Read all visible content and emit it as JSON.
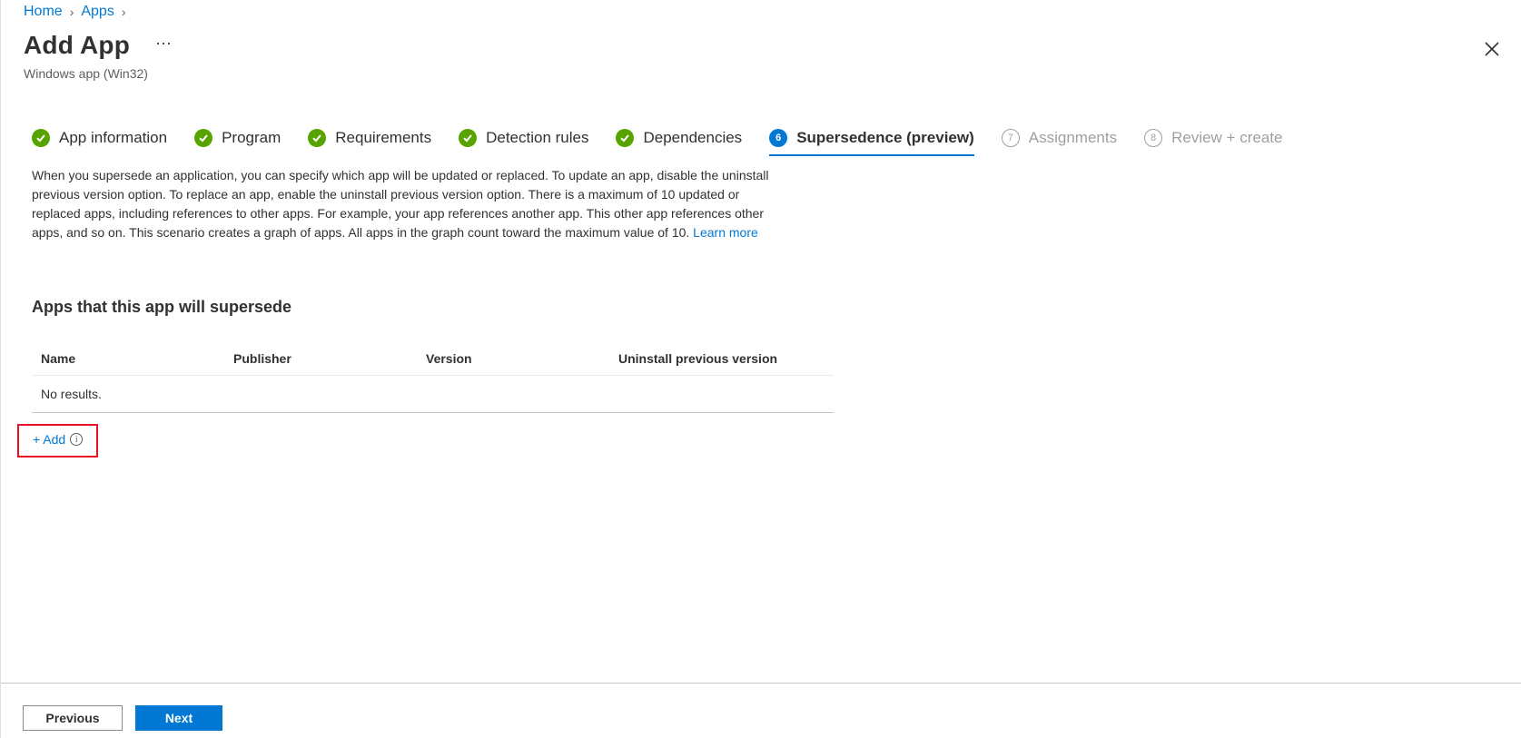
{
  "breadcrumb": {
    "items": [
      "Home",
      "Apps"
    ]
  },
  "header": {
    "title": "Add App",
    "more_label": "···",
    "subtitle": "Windows app (Win32)"
  },
  "wizard": {
    "steps": [
      {
        "number": "1",
        "label": "App information",
        "status": "complete"
      },
      {
        "number": "2",
        "label": "Program",
        "status": "complete"
      },
      {
        "number": "3",
        "label": "Requirements",
        "status": "complete"
      },
      {
        "number": "4",
        "label": "Detection rules",
        "status": "complete"
      },
      {
        "number": "5",
        "label": "Dependencies",
        "status": "complete"
      },
      {
        "number": "6",
        "label": "Supersedence (preview)",
        "status": "active"
      },
      {
        "number": "7",
        "label": "Assignments",
        "status": "upcoming"
      },
      {
        "number": "8",
        "label": "Review + create",
        "status": "upcoming"
      }
    ]
  },
  "description": {
    "text": "When you supersede an application, you can specify which app will be updated or replaced. To update an app, disable the uninstall previous version option. To replace an app, enable the uninstall previous version option. There is a maximum of 10 updated or replaced apps, including references to other apps. For example, your app references another app. This other app references other apps, and so on. This scenario creates a graph of apps. All apps in the graph count toward the maximum value of 10.",
    "link": "Learn more"
  },
  "section": {
    "title": "Apps that this app will supersede",
    "columns": [
      "Name",
      "Publisher",
      "Version",
      "Uninstall previous version"
    ],
    "empty_text": "No results.",
    "add_label": "+ Add",
    "info_icon_glyph": "i"
  },
  "footer": {
    "previous_label": "Previous",
    "next_label": "Next"
  },
  "colors": {
    "accent": "#0078d4",
    "complete": "#57a300",
    "highlight_box": "#e81123",
    "disabled_text": "#a19f9d"
  },
  "icons": {
    "complete_step": "checkmark-circle-icon",
    "close": "close-icon",
    "breadcrumb_separator": "chevron-right-icon",
    "info": "info-icon"
  }
}
